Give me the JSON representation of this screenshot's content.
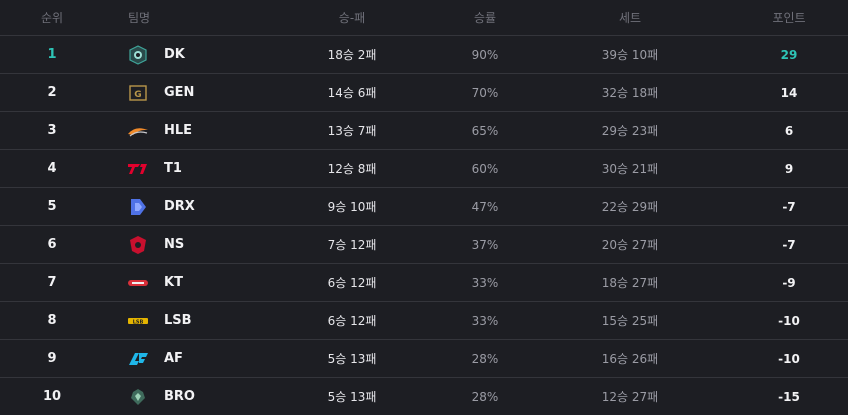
{
  "header": {
    "rank": "순위",
    "team": "팀명",
    "record": "승-패",
    "rate": "승률",
    "set": "세트",
    "points": "포인트"
  },
  "accent_color": "#2ec4b6",
  "rows": [
    {
      "rank": "1",
      "team": "DK",
      "record": "18승 2패",
      "rate": "90%",
      "set": "39승 10패",
      "points": "29",
      "logo": "dk-logo"
    },
    {
      "rank": "2",
      "team": "GEN",
      "record": "14승 6패",
      "rate": "70%",
      "set": "32승 18패",
      "points": "14",
      "logo": "gen-logo"
    },
    {
      "rank": "3",
      "team": "HLE",
      "record": "13승 7패",
      "rate": "65%",
      "set": "29승 23패",
      "points": "6",
      "logo": "hle-logo"
    },
    {
      "rank": "4",
      "team": "T1",
      "record": "12승 8패",
      "rate": "60%",
      "set": "30승 21패",
      "points": "9",
      "logo": "t1-logo"
    },
    {
      "rank": "5",
      "team": "DRX",
      "record": "9승 10패",
      "rate": "47%",
      "set": "22승 29패",
      "points": "-7",
      "logo": "drx-logo"
    },
    {
      "rank": "6",
      "team": "NS",
      "record": "7승 12패",
      "rate": "37%",
      "set": "20승 27패",
      "points": "-7",
      "logo": "ns-logo"
    },
    {
      "rank": "7",
      "team": "KT",
      "record": "6승 12패",
      "rate": "33%",
      "set": "18승 27패",
      "points": "-9",
      "logo": "kt-logo"
    },
    {
      "rank": "8",
      "team": "LSB",
      "record": "6승 12패",
      "rate": "33%",
      "set": "15승 25패",
      "points": "-10",
      "logo": "lsb-logo"
    },
    {
      "rank": "9",
      "team": "AF",
      "record": "5승 13패",
      "rate": "28%",
      "set": "16승 26패",
      "points": "-10",
      "logo": "af-logo"
    },
    {
      "rank": "10",
      "team": "BRO",
      "record": "5승 13패",
      "rate": "28%",
      "set": "12승 27패",
      "points": "-15",
      "logo": "bro-logo"
    }
  ]
}
